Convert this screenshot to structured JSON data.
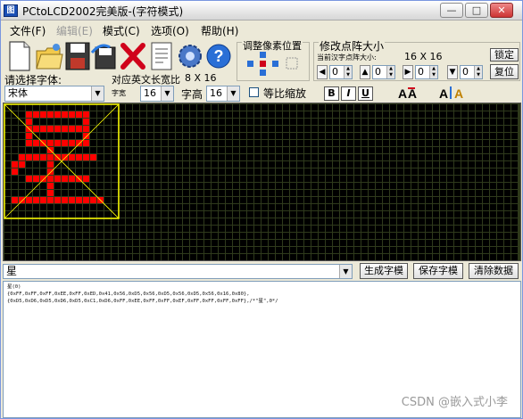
{
  "window": {
    "title": "PCtoLCD2002完美版-(字符模式)",
    "icon_text": "图"
  },
  "titlebar": {
    "minimize": "—",
    "maximize": "□",
    "close": "✕"
  },
  "menu": [
    {
      "label": "文件(F)",
      "enabled": true
    },
    {
      "label": "编辑(E)",
      "enabled": false
    },
    {
      "label": "模式(C)",
      "enabled": true
    },
    {
      "label": "选项(O)",
      "enabled": true
    },
    {
      "label": "帮助(H)",
      "enabled": true
    }
  ],
  "toolbar": {
    "font_label": "请选择字体:",
    "font_value": "宋体",
    "en_width_label": "对应英文长宽比",
    "en_width_value": "8 X 16",
    "width_label": "字宽",
    "width_value": "16",
    "height_label": "字高",
    "height_value": "16",
    "proportional_label": "等比缩放",
    "bold": "B",
    "italic": "I",
    "underline": "U"
  },
  "pixel_adjust": {
    "title": "调整像素位置"
  },
  "dot_matrix": {
    "title": "修改点阵大小",
    "current_label": "当前汉字点阵大小:",
    "current_size": "16 X 16",
    "spin_values": [
      "0",
      "0",
      "0",
      "0"
    ],
    "lock_label": "锁定",
    "restore_label": "复位"
  },
  "canvas": {
    "bg_color": "#2f3a1c",
    "pixel_on": "#ff0000",
    "pixel_off": "#000000",
    "grid_color": "#4a5a20",
    "frame_color": "#ffff00",
    "rows": [
      "0000000000000000",
      "0001111111110000",
      "0001000000010000",
      "0001111111110000",
      "0001000000010000",
      "0001111111110000",
      "0000001000000000",
      "0011111111111000",
      "0110001000000000",
      "0100001000000000",
      "0001111111110000",
      "0000001000000000",
      "0000001000000000",
      "0111111111111100",
      "0000000000000000",
      "0000000000000000"
    ]
  },
  "char_input": {
    "value": "星"
  },
  "actions": {
    "generate": "生成字模",
    "save": "保存字模",
    "clear": "清除数据"
  },
  "output": {
    "lines": [
      "星(0)",
      "",
      "{0xFF,0xFF,0xFF,0xEE,0xFF,0xED,0x41,0x56,0xD5,0x56,0xD5,0x56,0xD5,0x56,0x16,0x80},",
      "{0xD5,0xD6,0xD5,0xD6,0xD5,0xC1,0xD6,0xFF,0xEE,0xFF,0xFF,0xEF,0xFF,0xFF,0xFF,0xFF},/*\"星\",0*/"
    ]
  },
  "watermark": "CSDN @嵌入式小李"
}
